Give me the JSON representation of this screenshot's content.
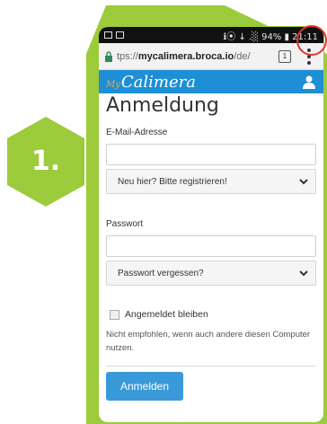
{
  "step": {
    "label": "1."
  },
  "colors": {
    "accent_green": "#9ccb3b",
    "app_blue": "#1e8fd6",
    "button_blue": "#3a9ad9",
    "highlight_red": "#e53434"
  },
  "statusbar": {
    "right": "ℹ⦿ ↓ .░ 94% ▮ 21:11"
  },
  "browser": {
    "url_prefix": "tps://",
    "url_host": "mycalimera.broca.io",
    "url_path": "/de/",
    "tabs_count": "1"
  },
  "app": {
    "logo_small": "My",
    "logo_text": "Calimera"
  },
  "form": {
    "title": "Anmeldung",
    "email_label": "E-Mail-Adresse",
    "email_value": "",
    "register_select": "Neu hier? Bitte registrieren!",
    "password_label": "Passwort",
    "password_value": "",
    "forgot_select": "Passwort vergessen?",
    "remember_label": "Angemeldet bleiben",
    "remember_hint": "Nicht empfohlen, wenn auch andere diesen Computer nutzen.",
    "submit_label": "Anmelden"
  }
}
